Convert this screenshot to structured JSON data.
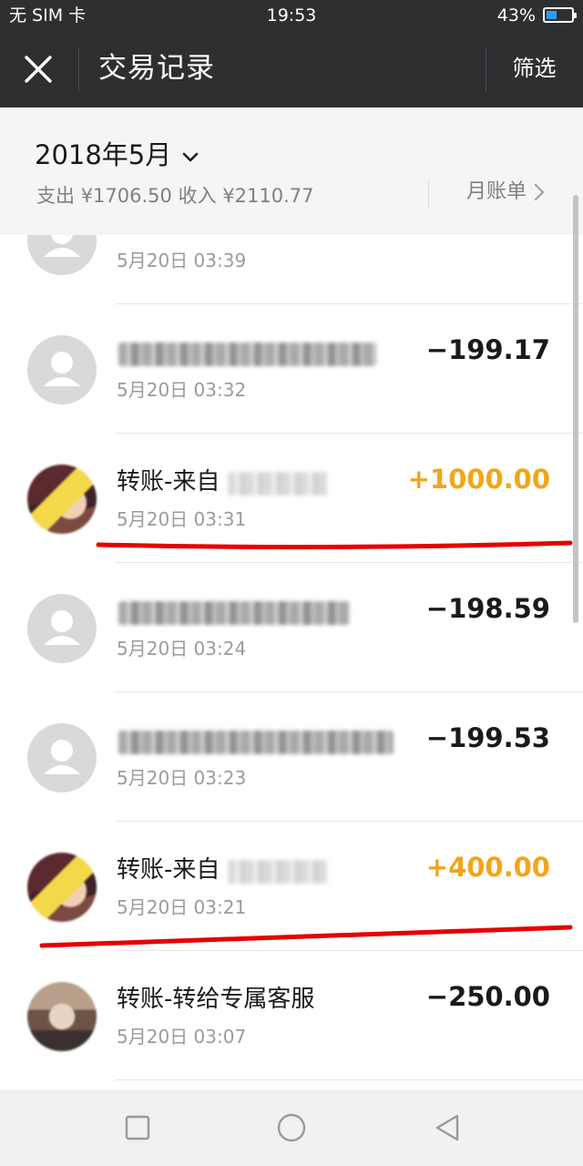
{
  "status_bar": {
    "carrier": "无 SIM 卡",
    "time": "19:53",
    "battery": "43%",
    "battery_level": 0.43
  },
  "header": {
    "title": "交易记录",
    "filter_label": "筛选",
    "close_icon": "close-icon"
  },
  "summary": {
    "month": "2018年5月",
    "expense_label": "支出",
    "expense_value": "¥1706.50",
    "income_label": "收入",
    "income_value": "¥2110.77",
    "monthly_bill_label": "月账单"
  },
  "transactions": [
    {
      "name": "",
      "time": "5月20日 03:39",
      "amount": ""
    },
    {
      "name": "",
      "time": "5月20日 03:32",
      "amount": "−199.17"
    },
    {
      "name": "转账-来自",
      "time": "5月20日 03:31",
      "amount": "+1000.00"
    },
    {
      "name": "",
      "time": "5月20日 03:24",
      "amount": "−198.59"
    },
    {
      "name": "",
      "time": "5月20日 03:23",
      "amount": "−199.53"
    },
    {
      "name": "转账-来自",
      "time": "5月20日 03:21",
      "amount": "+400.00"
    },
    {
      "name": "转账-转给专属客服",
      "time": "5月20日 03:07",
      "amount": "−250.00"
    }
  ],
  "colors": {
    "header_bg": "#2e2f31",
    "income": "#f2a51a",
    "annotation": "#e60000"
  },
  "nav": {
    "back_icon": "back-triangle-icon",
    "home_icon": "home-circle-icon",
    "recent_icon": "recent-square-icon"
  }
}
